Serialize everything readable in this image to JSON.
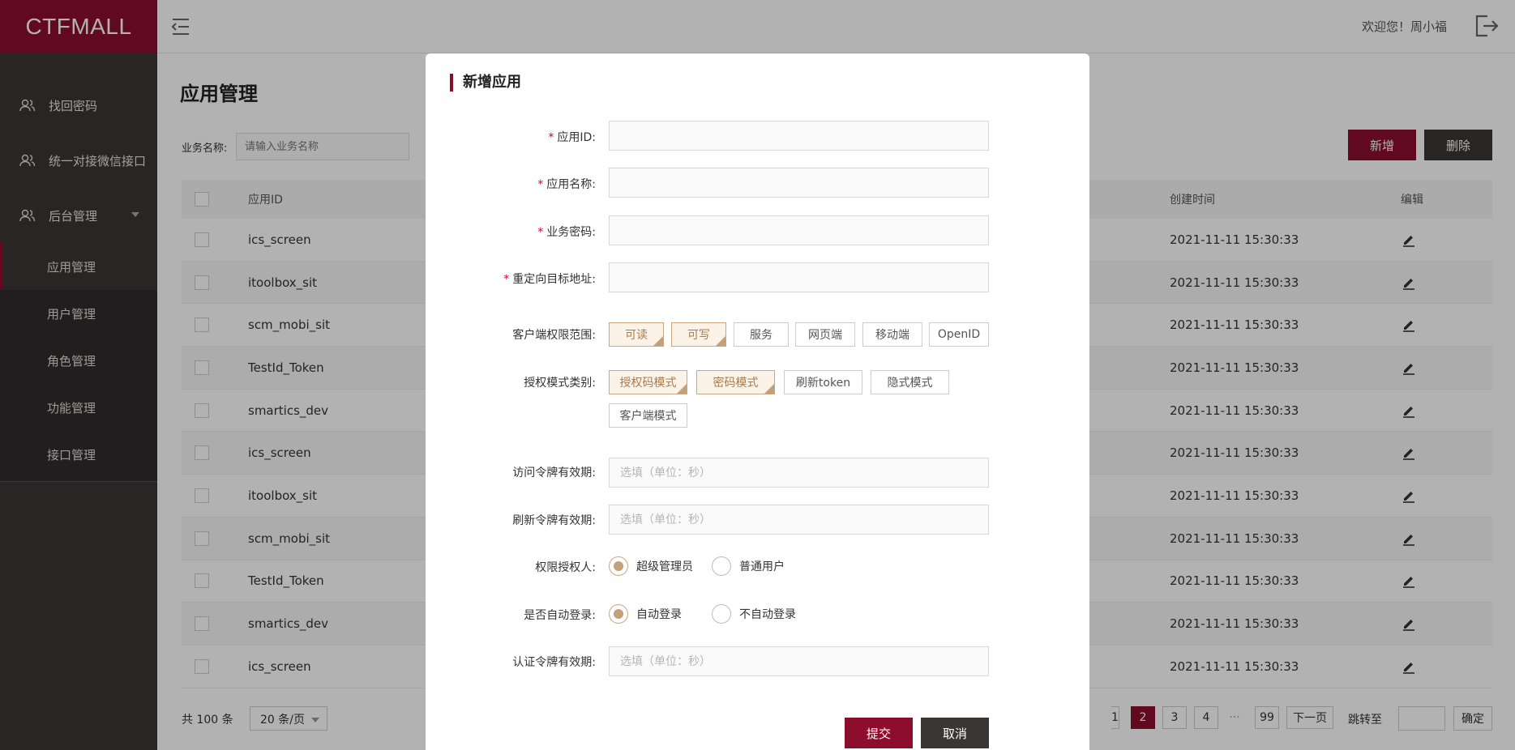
{
  "app": {
    "logo": "CTFMALL",
    "welcome": "欢迎您！周小福"
  },
  "sidebar": {
    "items": [
      {
        "label": "找回密码"
      },
      {
        "label": "统一对接微信接口"
      },
      {
        "label": "后台管理"
      }
    ],
    "sub_items": [
      {
        "label": "应用管理",
        "active": true
      },
      {
        "label": "用户管理"
      },
      {
        "label": "角色管理"
      },
      {
        "label": "功能管理"
      },
      {
        "label": "接口管理"
      }
    ]
  },
  "main": {
    "title": "应用管理",
    "filter_label": "业务名称:",
    "filter_placeholder": "请输入业务名称",
    "add_label": "新增",
    "delete_label": "删除",
    "columns": {
      "app_id": "应用ID",
      "created": "创建时间",
      "edit": "编辑"
    },
    "rows": [
      {
        "app_id": "ics_screen",
        "created": "2021-11-11  15:30:33"
      },
      {
        "app_id": "itoolbox_sit",
        "created": "2021-11-11  15:30:33"
      },
      {
        "app_id": "scm_mobi_sit",
        "created": "2021-11-11  15:30:33"
      },
      {
        "app_id": "TestId_Token",
        "created": "2021-11-11  15:30:33"
      },
      {
        "app_id": "smartics_dev",
        "created": "2021-11-11  15:30:33"
      },
      {
        "app_id": "ics_screen",
        "created": "2021-11-11  15:30:33"
      },
      {
        "app_id": "itoolbox_sit",
        "created": "2021-11-11  15:30:33"
      },
      {
        "app_id": "scm_mobi_sit",
        "created": "2021-11-11  15:30:33"
      },
      {
        "app_id": "TestId_Token",
        "created": "2021-11-11  15:30:33"
      },
      {
        "app_id": "smartics_dev",
        "created": "2021-11-11  15:30:33"
      },
      {
        "app_id": "ics_screen",
        "created": "2021-11-11  15:30:33"
      }
    ],
    "pagination": {
      "total": "共 100 条",
      "per_page": "20 条/页",
      "pages": [
        "1",
        "2",
        "3",
        "4",
        "···",
        "99"
      ],
      "current": "2",
      "next": "下一页",
      "jump_label": "跳转至",
      "confirm": "确定"
    }
  },
  "modal": {
    "title": "新增应用",
    "fields": {
      "app_id": "应用ID:",
      "app_name": "应用名称:",
      "biz_secret": "业务密码:",
      "redirect": "重定向目标地址:",
      "client_scope": "客户端权限范围:",
      "grant_types": "授权模式类别:",
      "access_token": "访问令牌有效期:",
      "refresh_token": "刷新令牌有效期:",
      "grantor": "权限授权人:",
      "auto_login": "是否自动登录:",
      "auth_token": "认证令牌有效期:"
    },
    "required_mark": "*",
    "placeholder_seconds": "选填（单位：秒）",
    "scope_options": [
      {
        "label": "可读",
        "selected": true
      },
      {
        "label": "可写",
        "selected": true
      },
      {
        "label": "服务",
        "selected": false
      },
      {
        "label": "网页端",
        "selected": false
      },
      {
        "label": "移动端",
        "selected": false
      },
      {
        "label": "OpenID",
        "selected": false
      }
    ],
    "grant_options": [
      {
        "label": "授权码模式",
        "selected": true
      },
      {
        "label": "密码模式",
        "selected": true
      },
      {
        "label": "刷新token",
        "selected": false
      },
      {
        "label": "隐式模式",
        "selected": false
      },
      {
        "label": "客户端模式",
        "selected": false
      }
    ],
    "grantor_options": [
      {
        "label": "超级管理员",
        "selected": true
      },
      {
        "label": "普通用户",
        "selected": false
      }
    ],
    "auto_login_options": [
      {
        "label": "自动登录",
        "selected": true
      },
      {
        "label": "不自动登录",
        "selected": false
      }
    ],
    "submit": "提交",
    "cancel": "取消"
  },
  "colors": {
    "brand": "#8c0e2c",
    "sidebar": "#3a3634",
    "selected_tag": "#c4a07a"
  }
}
